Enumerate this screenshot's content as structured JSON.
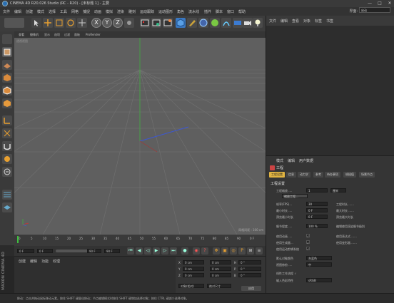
{
  "window": {
    "title": "CINEMA 4D R20.026 Studio (RC - R20) - [未标题 1] - 主要",
    "minimize": "—",
    "maximize": "□",
    "close": "✕"
  },
  "menu": [
    "文件",
    "编辑",
    "创建",
    "模式",
    "选择",
    "工具",
    "网格",
    "捕捉",
    "动画",
    "模拟",
    "渲染",
    "雕刻",
    "运动跟踪",
    "运动图形",
    "角色",
    "流水线",
    "插件",
    "脚本",
    "窗口",
    "帮助"
  ],
  "toolbar": {
    "icons": [
      "undo-icon",
      "live-select-icon",
      "move-icon",
      "scale-icon",
      "rotate-icon",
      "recent-tool-icon",
      "x-axis-icon",
      "y-axis-icon",
      "z-axis-icon",
      "world-coord-icon",
      "render-view-icon",
      "render-picture-viewer-icon",
      "edit-render-settings-icon",
      "cube-icon",
      "pen-icon",
      "subdivision-icon",
      "cloner-icon",
      "deformer-icon",
      "floor-icon",
      "camera-icon",
      "light-icon"
    ],
    "axis_labels": {
      "x": "X",
      "y": "Y",
      "z": "Z"
    }
  },
  "viewport": {
    "menu": [
      "查看",
      "摄像机",
      "显示",
      "选项",
      "过滤",
      "面板",
      "ProRender"
    ],
    "view_name": "透视视图",
    "grid_distance": "网格间距 : 100 cm"
  },
  "timeline": {
    "ticks": [
      "0",
      "5",
      "10",
      "15",
      "20",
      "25",
      "30",
      "35",
      "40",
      "45",
      "50",
      "55",
      "60",
      "65",
      "70",
      "75",
      "80",
      "85",
      "90"
    ],
    "end_frame": "0 F"
  },
  "transport": {
    "start": "0 F",
    "min": "0 F",
    "max": "90 F",
    "end": "90 F"
  },
  "material_panel": {
    "tabs": [
      "创建",
      "编辑",
      "功能",
      "纹理"
    ]
  },
  "coord_panel": {
    "rows": [
      {
        "axis": "X",
        "pos": "0 cm",
        "size": "0 cm",
        "rot_label": "H",
        "rot": "0 °"
      },
      {
        "axis": "Y",
        "pos": "0 cm",
        "size": "0 cm",
        "rot_label": "P",
        "rot": "0 °"
      },
      {
        "axis": "Z",
        "pos": "0 cm",
        "size": "0 cm",
        "rot_label": "B",
        "rot": "0 °"
      }
    ],
    "mode": "对象(相对)",
    "size_mode": "绝对尺寸",
    "apply": "应用"
  },
  "object_manager": {
    "tabs": [
      "文件",
      "编辑",
      "查看",
      "对象",
      "标签",
      "书签"
    ],
    "layout_label": "界面:",
    "layout_value": "启动"
  },
  "attribute_manager": {
    "tabs": [
      "模式",
      "编辑",
      "用户数据"
    ],
    "object_title": "工程",
    "subtabs": [
      "工程设置",
      "信息",
      "动力学",
      "参考",
      "待办事项",
      "帧插值",
      "场景节点"
    ],
    "section": "工程设置",
    "fields": [
      {
        "label": "工程缩放 ....",
        "value": "1",
        "unit": "厘米"
      },
      {
        "label": "帧率(FPS)...",
        "value": "30",
        "right": "工程时长 ......"
      },
      {
        "label": "最小时长 ....",
        "value": "0 F",
        "right": "最大时长 ......"
      },
      {
        "label": "预览最小时长",
        "value": "0 F",
        "right": "预览最大时长"
      },
      {
        "label": "细节程度 ....",
        "value": "100 %",
        "right": "编辑使用渲染细节级别"
      }
    ],
    "scale_button": "缩放工程...",
    "checks": [
      {
        "label": "使用动画 ....",
        "checked": "✓",
        "right": "使用表达式 ......"
      },
      {
        "label": "使用生成器 ..",
        "checked": "✓",
        "right": "使用变形器 ......"
      },
      {
        "label": "使用运动剪辑系统",
        "checked": "✓",
        "right": ""
      }
    ],
    "default_color_label": "默认对象颜色",
    "default_color_value": "灰蓝色",
    "view_clip_label": "视图修剪 ....",
    "view_clip_value": "中",
    "linear_workflow": "线性工作流程 ✓",
    "color_profile_label": "输入色彩特性",
    "color_profile_value": "sRGB"
  },
  "status": "移动：点击并拖动鼠标移动元素。按住 SHIFT 键量化移动；节点编辑模式时按住 SHIFT 键增加选择对象；按住 CTRL 键减少选择对象。",
  "logo": "MAXON CINEMA 4D"
}
